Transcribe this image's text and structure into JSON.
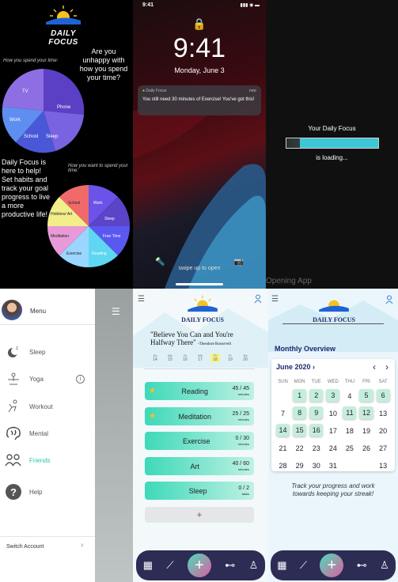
{
  "panel1": {
    "logo_text": "DAILY FOCUS",
    "spend_caption": "How you spend your time:",
    "question": "Are you unhappy with how you spend your time?",
    "pitch": "Daily Focus is here to help! Set habits and track your goal progress to live a more productive life!",
    "want_caption": "How you want to spend your time:",
    "pie1_labels": [
      "TV",
      "Phone",
      "Work",
      "School",
      "Sleep"
    ],
    "pie2_labels": [
      "School",
      "Work",
      "Hobbies/ Art",
      "Sleep",
      "Meditation",
      "Free Time",
      "Exercise",
      "Reading"
    ]
  },
  "panel2": {
    "time": "9:41",
    "big_time": "9:41",
    "date": "Monday, June 3",
    "notif_app": "Daily Focus",
    "notif_time": "now",
    "notif_message": "You still need 30 minutes of Exercise! You've got this!",
    "swipe": "swipe up to open"
  },
  "panel3": {
    "title": "Your Daily Focus",
    "loading": "is loading...",
    "progress": 0.85,
    "caption": "Opening App"
  },
  "panel4": {
    "menu_title": "Menu",
    "items": [
      "Sleep",
      "Yoga",
      "Workout",
      "Mental",
      "Friends",
      "Help"
    ],
    "switch_account": "Switch Account"
  },
  "panel5": {
    "logo_text": "DAILY FOCUS",
    "quote": "\"Believe You Can and You're Halfway There\"",
    "author": "-Theodore Roosevelt",
    "week_days": [
      "Su",
      "Mo",
      "Tu",
      "We",
      "Th",
      "Fr",
      "Sa"
    ],
    "week_dates": [
      "14",
      "15",
      "16",
      "17",
      "18",
      "19",
      "20"
    ],
    "activities": [
      {
        "name": "Reading",
        "value": "45 / 45",
        "unit": "minutes",
        "star": true
      },
      {
        "name": "Meditation",
        "value": "25 / 25",
        "unit": "minutes",
        "star": true
      },
      {
        "name": "Exercise",
        "value": "0 / 30",
        "unit": "minutes",
        "star": false
      },
      {
        "name": "Art",
        "value": "40 / 60",
        "unit": "minutes",
        "star": false
      },
      {
        "name": "Sleep",
        "value": "0 / 2",
        "unit": "tasks",
        "star": false
      }
    ],
    "add": "+"
  },
  "panel6": {
    "logo_text": "DAILY FOCUS",
    "overview_title": "Monthly Overview",
    "month": "June 2020",
    "day_headers": [
      "SUN",
      "MON",
      "TUE",
      "WED",
      "THU",
      "FRI",
      "SAT"
    ],
    "days": [
      "",
      "1",
      "2",
      "3",
      "4",
      "5",
      "6",
      "7",
      "8",
      "9",
      "10",
      "11",
      "12",
      "13",
      "14",
      "15",
      "16",
      "17",
      "18",
      "19",
      "20",
      "21",
      "22",
      "23",
      "24",
      "25",
      "26",
      "27",
      "28",
      "29",
      "30",
      "31",
      "",
      "",
      "13"
    ],
    "highlighted": [
      "1",
      "2",
      "3",
      "5",
      "6",
      "8",
      "9",
      "11",
      "12",
      "14",
      "15",
      "16"
    ],
    "tagline": "Track your progress and work towards keeping your streak!"
  },
  "colors": {
    "teal": "#3ed9b8",
    "navy": "#2c2c55",
    "purple": "#5b3fc4",
    "friends": "#2ec4a6"
  }
}
